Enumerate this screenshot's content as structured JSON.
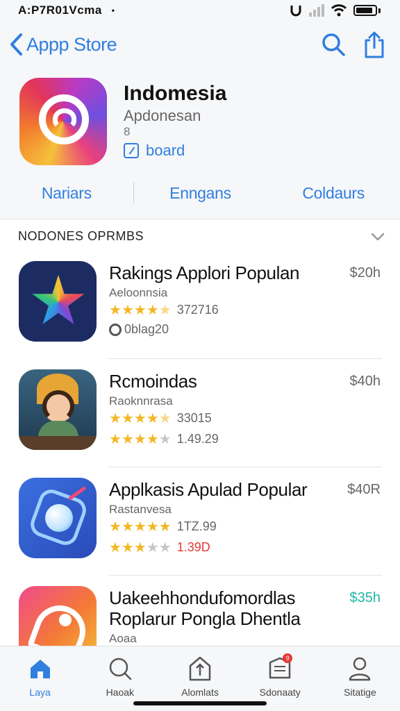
{
  "status_bar": {
    "carrier": "A:P7R01Vcma",
    "dot": "•"
  },
  "nav": {
    "back_label": "Appp Store"
  },
  "app": {
    "title": "Indomesia",
    "subtitle": "Apdonesan",
    "age": "8",
    "link_label": "board"
  },
  "segments": [
    "Nariars",
    "Enngans",
    "Coldaurs"
  ],
  "section": {
    "title": "NODONES OPRMBS"
  },
  "apps": [
    {
      "title": "Rakings Applori Populan",
      "price": "$20h",
      "subtitle": "Aeloonnsia",
      "lines": [
        {
          "type": "rating",
          "stars": 4.5,
          "text": "372716"
        },
        {
          "type": "badge",
          "text": "0blag20"
        }
      ]
    },
    {
      "title": "Rcmoindas",
      "price": "$40h",
      "subtitle": "Raoknnrasa",
      "lines": [
        {
          "type": "rating",
          "stars": 4.5,
          "text": "33015"
        },
        {
          "type": "rating",
          "stars": 4,
          "text": "1.49.29"
        }
      ]
    },
    {
      "title": "Applkasis Apulad Popular",
      "price": "$40R",
      "subtitle": "Rastanvesa",
      "lines": [
        {
          "type": "rating",
          "stars": 5,
          "text": "1TZ.99"
        },
        {
          "type": "rating",
          "stars": 3,
          "text": "1.39D"
        }
      ]
    },
    {
      "title": "Uakeehhondufomordlas",
      "title2": "Roplarur Pongla Dhentla",
      "price": "$35h",
      "subtitle": "Aoaa"
    }
  ],
  "tabs": [
    {
      "label": "Laya",
      "icon": "home-icon",
      "active": true
    },
    {
      "label": "Haoak",
      "icon": "search-icon"
    },
    {
      "label": "Alomlats",
      "icon": "upload-icon"
    },
    {
      "label": "Sdonaaty",
      "icon": "inbox-icon",
      "badge": "9"
    },
    {
      "label": "Sitatige",
      "icon": "person-icon"
    }
  ],
  "colors": {
    "accent": "#2f7ee0",
    "star": "#f2b824",
    "price_green": "#1fb7a4",
    "error": "#e53935"
  }
}
